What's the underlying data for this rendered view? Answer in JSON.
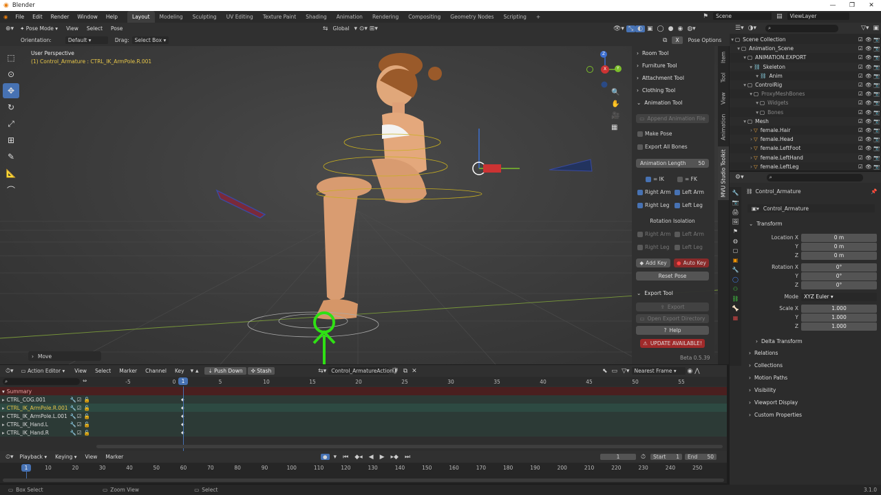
{
  "app": {
    "title": "Blender",
    "version": "3.1.0"
  },
  "menus": [
    "File",
    "Edit",
    "Render",
    "Window",
    "Help"
  ],
  "workspaces": [
    "Layout",
    "Modeling",
    "Sculpting",
    "UV Editing",
    "Texture Paint",
    "Shading",
    "Animation",
    "Rendering",
    "Compositing",
    "Geometry Nodes",
    "Scripting"
  ],
  "scene": {
    "name": "Scene",
    "view_layer": "ViewLayer"
  },
  "viewport": {
    "mode": "Pose Mode",
    "menus": [
      "View",
      "Select",
      "Pose"
    ],
    "orientation_label": "Orientation:",
    "orientation_value": "Default",
    "drag_label": "Drag:",
    "drag_value": "Select Box",
    "transform_orientation": "Global",
    "options_label": "Pose Options",
    "info_line1": "User Perspective",
    "info_line2": "(1) Control_Armature : CTRL_IK_ArmPole.R.001",
    "last_op": "Move",
    "gizmo": {
      "x": "X",
      "y": "Y",
      "z": "Z"
    }
  },
  "npanel": {
    "tabs": [
      "Item",
      "Tool",
      "View",
      "Animation",
      "MVU Studio Toolkit"
    ],
    "room_tool": "Room Tool",
    "furniture_tool": "Furniture Tool",
    "attachment_tool": "Attachment Tool",
    "clothing_tool": "Clothing Tool",
    "animation_tool": "Animation Tool",
    "append_animation": "Append Animation File",
    "make_pose": "Make Pose",
    "export_all_bones": "Export All Bones",
    "animation_length_label": "Animation Length",
    "animation_length_value": "50",
    "ik": "= IK",
    "fk": "= FK",
    "right_arm": "Right Arm",
    "left_arm": "Left Arm",
    "right_leg": "Right Leg",
    "left_leg": "Left Leg",
    "rotation_isolation": "Rotation Isolation",
    "add_key": "Add Key",
    "auto_key": "Auto Key",
    "reset_pose": "Reset Pose",
    "export_tool": "Export Tool",
    "export": "Export",
    "open_export_dir": "Open Export Directory",
    "help": "Help",
    "update": "UPDATE AVAILABLE!",
    "beta": "Beta 0.5.39"
  },
  "outliner": {
    "rows": [
      {
        "label": "Scene Collection",
        "indent": 0,
        "icon": "collection-icon"
      },
      {
        "label": "Animation_Scene",
        "indent": 1,
        "icon": "collection-icon"
      },
      {
        "label": "ANIMATION.EXPORT",
        "indent": 2,
        "icon": "collection-icon"
      },
      {
        "label": "Skeleton",
        "indent": 3,
        "icon": "armature-icon"
      },
      {
        "label": "Anim",
        "indent": 4,
        "icon": "armature-icon"
      },
      {
        "label": "ControlRig",
        "indent": 2,
        "icon": "collection-icon"
      },
      {
        "label": "ProxyMeshBones",
        "indent": 3,
        "icon": "collection-icon"
      },
      {
        "label": "Widgets",
        "indent": 4,
        "icon": "collection-icon"
      },
      {
        "label": "Bones",
        "indent": 4,
        "icon": "collection-icon"
      },
      {
        "label": "Mesh",
        "indent": 2,
        "icon": "collection-icon"
      },
      {
        "label": "female.Hair",
        "indent": 3,
        "icon": "mesh-icon"
      },
      {
        "label": "female.Head",
        "indent": 3,
        "icon": "mesh-icon"
      },
      {
        "label": "female.LeftFoot",
        "indent": 3,
        "icon": "mesh-icon"
      },
      {
        "label": "female.LeftHand",
        "indent": 3,
        "icon": "mesh-icon"
      },
      {
        "label": "female.LeftLeg",
        "indent": 3,
        "icon": "mesh-icon"
      }
    ]
  },
  "properties": {
    "object_name": "Control_Armature",
    "datablock": "Control_Armature",
    "transform": "Transform",
    "location_label": "Location X",
    "rotation_label": "Rotation X",
    "scale_label": "Scale X",
    "y": "Y",
    "z": "Z",
    "loc": [
      "0 m",
      "0 m",
      "0 m"
    ],
    "rot": [
      "0°",
      "0°",
      "0°"
    ],
    "mode_label": "Mode",
    "mode_value": "XYZ Euler",
    "scale": [
      "1.000",
      "1.000",
      "1.000"
    ],
    "delta": "Delta Transform",
    "sections": [
      "Relations",
      "Collections",
      "Motion Paths",
      "Visibility",
      "Viewport Display",
      "Custom Properties"
    ]
  },
  "action_editor": {
    "mode": "Action Editor",
    "menus": [
      "View",
      "Select",
      "Marker",
      "Channel",
      "Key"
    ],
    "push_down": "Push Down",
    "stash": "Stash",
    "action": "Control_ArmatureAction",
    "snap": "Nearest Frame",
    "summary": "Summary",
    "channels": [
      "CTRL_COG.001",
      "CTRL_IK_ArmPole.R.001",
      "CTRL_IK_ArmPole.L.001",
      "CTRL_IK_Hand.L",
      "CTRL_IK_Hand.R"
    ],
    "ticks": [
      "-5",
      "0",
      "5",
      "10",
      "15",
      "20",
      "25",
      "30",
      "35",
      "40",
      "45",
      "50",
      "55"
    ],
    "current": "1"
  },
  "timeline": {
    "menus": [
      "Playback",
      "Keying",
      "View",
      "Marker"
    ],
    "frame": "1",
    "start_label": "Start",
    "start": "1",
    "end_label": "End",
    "end": "50",
    "ticks": [
      "10",
      "20",
      "30",
      "40",
      "50",
      "60",
      "70",
      "80",
      "90",
      "100",
      "110",
      "120",
      "130",
      "140",
      "150",
      "160",
      "170",
      "180",
      "190",
      "200",
      "210",
      "220",
      "230",
      "240",
      "250"
    ],
    "current": "1"
  },
  "status": {
    "a": "Box Select",
    "b": "Zoom View",
    "c": "Select",
    "version": "3.1.0"
  }
}
